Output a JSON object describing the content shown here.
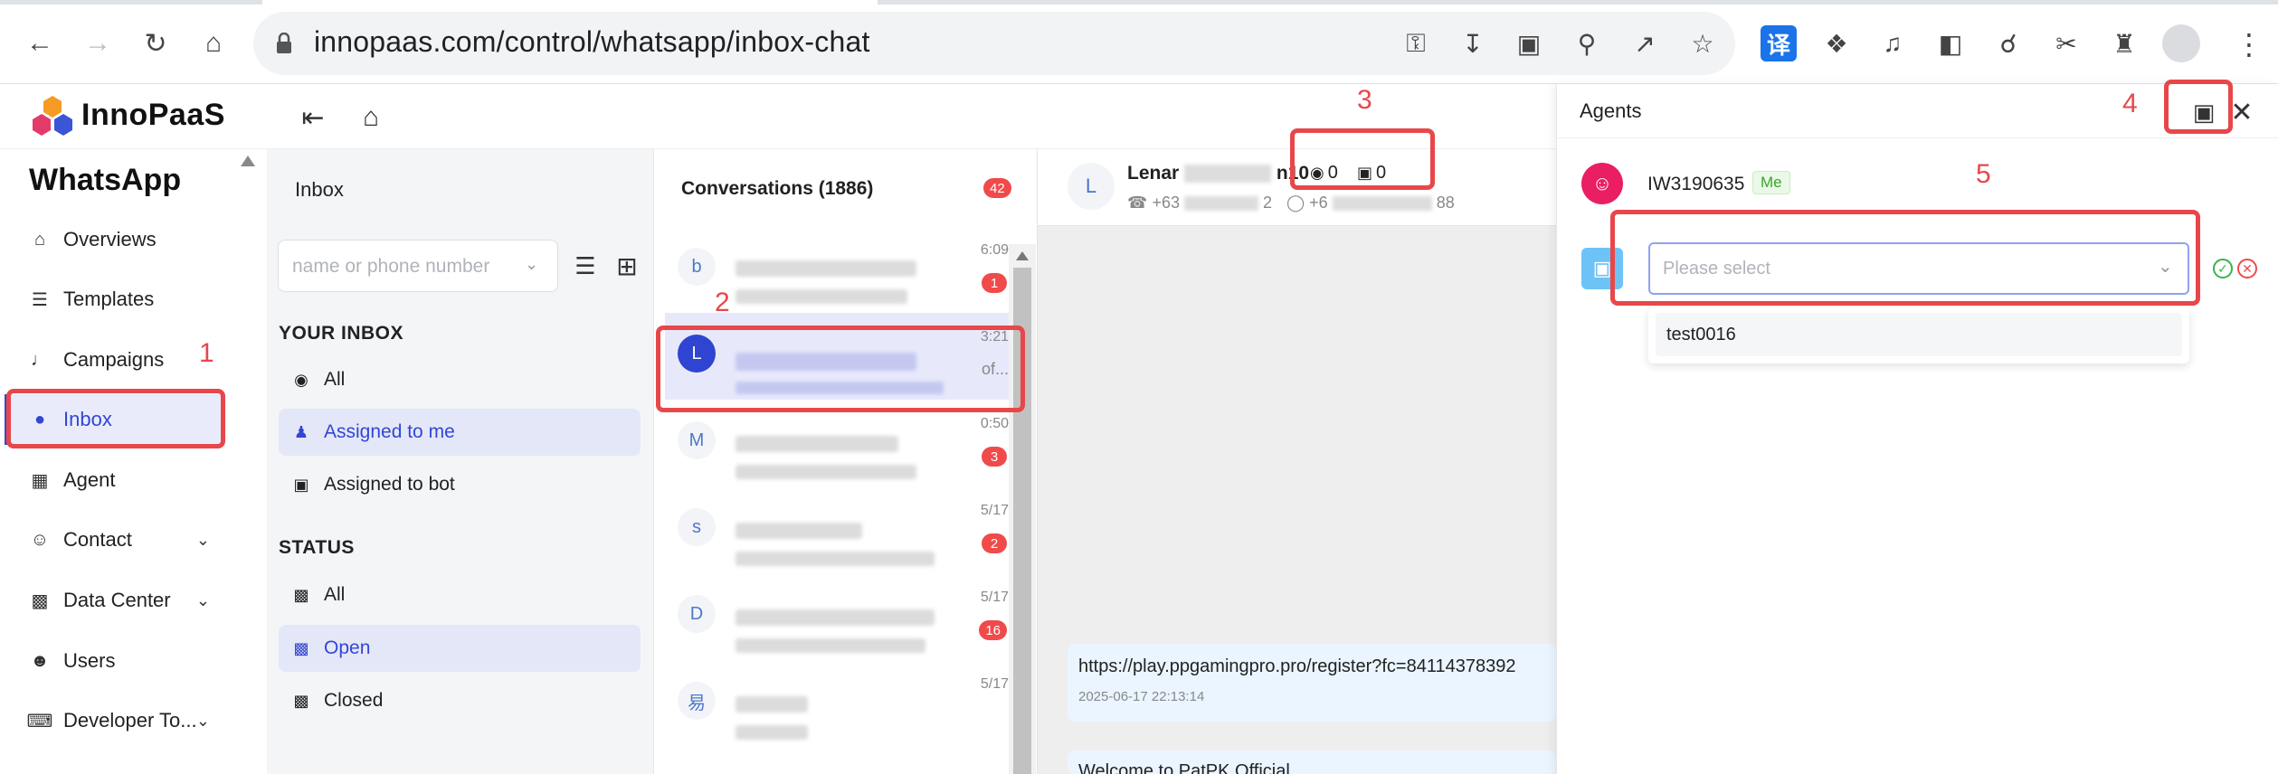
{
  "browser": {
    "url": "innopaas.com/control/whatsapp/inbox-chat",
    "ext_translate_label": "译"
  },
  "app": {
    "brand": "InnoPaaS",
    "section_title": "WhatsApp"
  },
  "nav": {
    "items": [
      {
        "label": "Overviews",
        "icon": "home-outline-icon"
      },
      {
        "label": "Templates",
        "icon": "list-icon"
      },
      {
        "label": "Campaigns",
        "icon": "megaphone-icon"
      },
      {
        "label": "Inbox",
        "icon": "chat-bubble-icon",
        "active": true
      },
      {
        "label": "Agent",
        "icon": "robot-icon"
      },
      {
        "label": "Contact",
        "icon": "user-icon",
        "expandable": true
      },
      {
        "label": "Data Center",
        "icon": "bar-chart-icon",
        "expandable": true
      },
      {
        "label": "Users",
        "icon": "users-icon"
      },
      {
        "label": "Developer To...",
        "icon": "code-icon",
        "expandable": true
      }
    ]
  },
  "inbox": {
    "title": "Inbox",
    "search_placeholder": "name or phone number",
    "your_inbox_label": "YOUR INBOX",
    "your_inbox_items": [
      "All",
      "Assigned to me",
      "Assigned to bot"
    ],
    "status_label": "STATUS",
    "status_items": [
      "All",
      "Open",
      "Closed"
    ]
  },
  "conversations": {
    "title": "Conversations (1886)",
    "unread_total": "42",
    "items": [
      {
        "initial": "b",
        "time": "6:09",
        "badge": "1"
      },
      {
        "initial": "L",
        "time": "3:21",
        "snippet": "of...",
        "active": true
      },
      {
        "initial": "M",
        "time": "0:50",
        "badge": "3"
      },
      {
        "initial": "s",
        "time": "5/17",
        "badge": "2"
      },
      {
        "initial": "D",
        "time": "5/17",
        "badge": "16"
      },
      {
        "initial": "易",
        "time": "5/17"
      }
    ]
  },
  "chat": {
    "avatar_initial": "L",
    "name_start": "Lenar",
    "name_end": "n10",
    "phone_left": "+63",
    "phone_left_end": "2",
    "phone_right": "+6",
    "phone_right_end": "88",
    "agent_count": "0",
    "bot_count": "0",
    "messages": [
      {
        "text": "https://play.ppgamingpro.pro/register?fc=84114378392",
        "time": "2025-06-17 22:13:14"
      },
      {
        "text": "Welcome to PatPK Official"
      }
    ]
  },
  "agents_drawer": {
    "title": "Agents",
    "agent_id": "IW3190635",
    "me_tag": "Me",
    "select_placeholder": "Please select",
    "options": [
      "test0016"
    ]
  },
  "annotations": [
    "1",
    "2",
    "3",
    "4",
    "5"
  ],
  "colors": {
    "accent": "#3346d3",
    "annotation": "#e8474a",
    "badge": "#f04a4a"
  }
}
